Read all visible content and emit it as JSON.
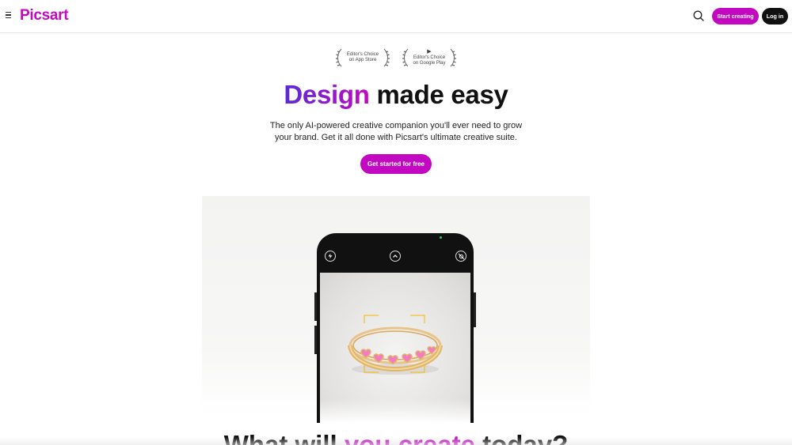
{
  "header": {
    "logo": "Picsart",
    "start_creating": "Start creating",
    "login": "Log in"
  },
  "awards": [
    {
      "glyph": "",
      "line1": "Editor's Choice",
      "line2": "on App Store"
    },
    {
      "glyph": "▶",
      "line1": "Editor's Choice",
      "line2": "on Google Play"
    }
  ],
  "hero": {
    "title_accent": "Design",
    "title_rest": " made easy",
    "subtitle": "The only AI-powered creative companion you'll ever need to grow your brand. Get it all done with Picsart's ultimate creative suite.",
    "cta": "Get started for free"
  },
  "phone": {
    "icons": [
      "flash-icon",
      "chevron-up-icon",
      "camera-off-icon"
    ]
  },
  "next_section": {
    "title_start": "What will ",
    "title_accent": "you create",
    "title_end": " today?"
  },
  "colors": {
    "brand": "#c209c1",
    "dark": "#111111",
    "ring_gold": "#e0b56a",
    "heart_pink": "#f27bc4",
    "focus_frame": "#f5b800"
  }
}
